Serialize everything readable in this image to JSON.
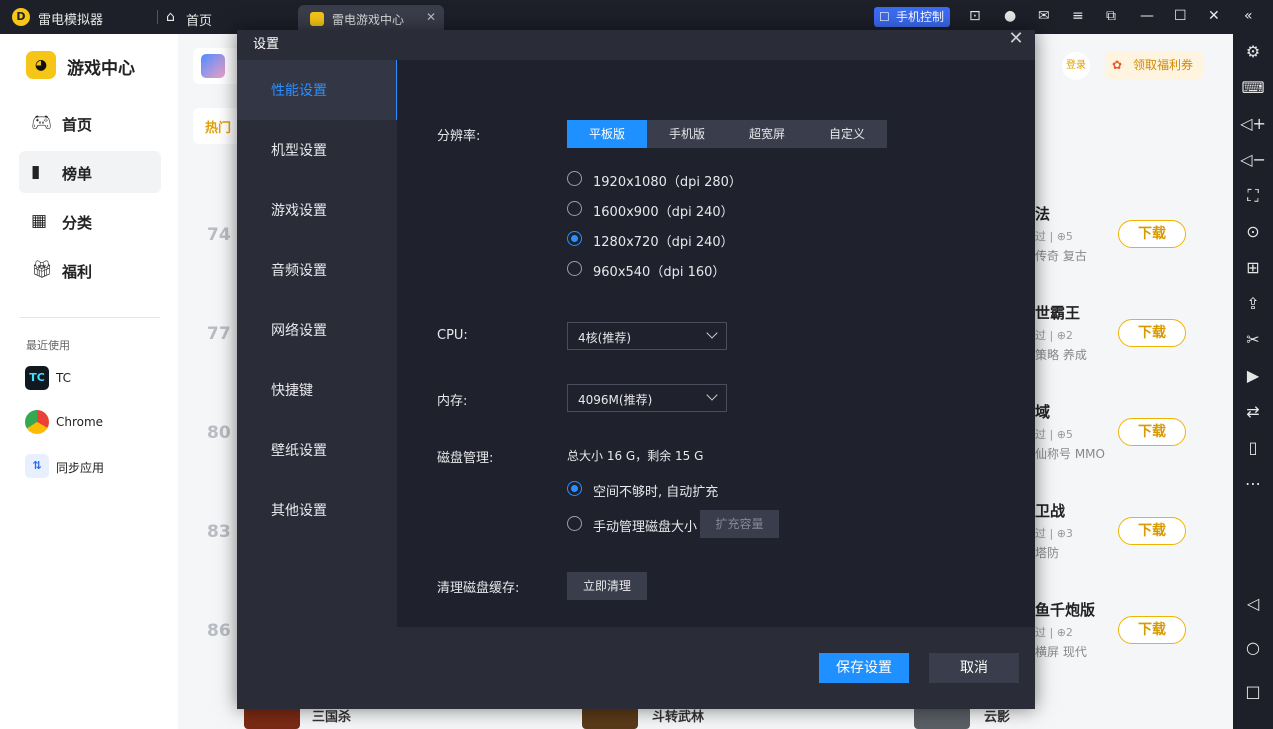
{
  "titlebar": {
    "app_name": "雷电模拟器",
    "home_tab": "首页",
    "game_tab": "雷电游戏中心",
    "phone_control": "手机控制"
  },
  "sidebar": {
    "brand": "游戏中心",
    "nav": [
      {
        "label": "首页"
      },
      {
        "label": "榜单"
      },
      {
        "label": "分类"
      },
      {
        "label": "福利"
      }
    ],
    "recent_title": "最近使用",
    "recent": [
      {
        "label": "TC"
      },
      {
        "label": "Chrome"
      },
      {
        "label": "同步应用"
      }
    ]
  },
  "background": {
    "hot_label": "热门",
    "login": "登录",
    "welfare": "领取福利券",
    "ranks": [
      "74",
      "77",
      "80",
      "83",
      "86"
    ],
    "rows": [
      {
        "name": "法",
        "meta": "过 | ⊕5",
        "tags": "传奇  复古"
      },
      {
        "name": "世霸王",
        "meta": "过 | ⊕2",
        "tags": "策略  养成"
      },
      {
        "name": "域",
        "meta": "过 | ⊕5",
        "tags": "仙称号  MMO"
      },
      {
        "name": "卫战",
        "meta": "过 | ⊕3",
        "tags": "塔防"
      },
      {
        "name": "鱼千炮版",
        "meta": "过 | ⊕2",
        "tags": "横屏  现代"
      }
    ],
    "download_label": "下载",
    "bottom_row": [
      "三国杀",
      "斗转武林",
      "云影"
    ]
  },
  "dialog": {
    "title": "设置",
    "menu": [
      {
        "label": "性能设置"
      },
      {
        "label": "机型设置"
      },
      {
        "label": "游戏设置"
      },
      {
        "label": "音频设置"
      },
      {
        "label": "网络设置"
      },
      {
        "label": "快捷键"
      },
      {
        "label": "壁纸设置"
      },
      {
        "label": "其他设置"
      }
    ],
    "resolution_label": "分辨率:",
    "resolution_tabs": [
      "平板版",
      "手机版",
      "超宽屏",
      "自定义"
    ],
    "resolution_options": [
      "1920x1080（dpi 280）",
      "1600x900（dpi 240）",
      "1280x720（dpi 240）",
      "960x540（dpi 160）"
    ],
    "selected_resolution": 2,
    "cpu_label": "CPU:",
    "cpu_value": "4核(推荐)",
    "memory_label": "内存:",
    "memory_value": "4096M(推荐)",
    "disk_label": "磁盘管理:",
    "disk_summary": "总大小 16 G，剩余 15 G",
    "disk_options": [
      "空间不够时, 自动扩充",
      "手动管理磁盘大小"
    ],
    "expand_button": "扩充容量",
    "cache_label": "清理磁盘缓存:",
    "clear_button": "立即清理",
    "save_button": "保存设置",
    "cancel_button": "取消"
  }
}
